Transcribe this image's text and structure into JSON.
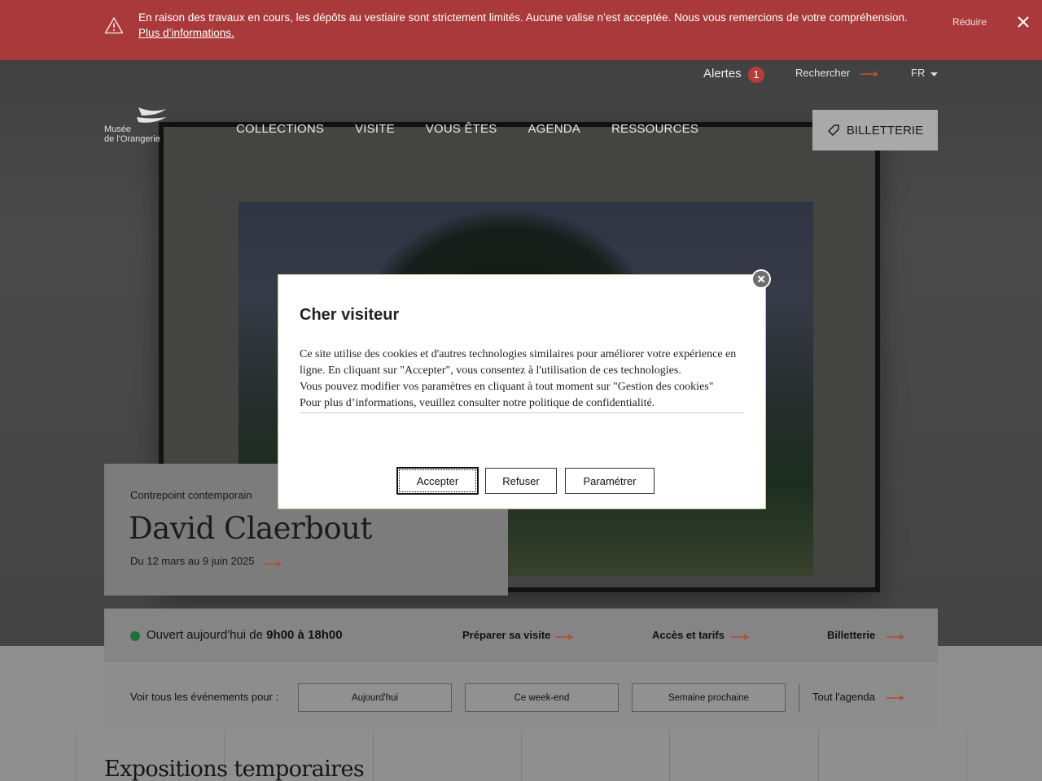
{
  "alert_banner": {
    "message": "En raison des travaux en cours, les dépôts au vestiaire sont strictement limités. Aucune valise n’est acceptée. Nous vous remercions de votre compréhension.",
    "link_label": "Plus d’informations.",
    "reduce_label": "Réduire"
  },
  "utility": {
    "alerts_label": "Alertes",
    "alerts_count": "1",
    "search_label": "Rechercher",
    "language": "FR"
  },
  "header": {
    "logo_line1": "Musée",
    "logo_line2": "de l'Orangerie",
    "nav": [
      "COLLECTIONS",
      "VISITE",
      "VOUS ÊTES",
      "AGENDA",
      "RESSOURCES"
    ],
    "ticket_label": "BILLETTERIE"
  },
  "exhibition": {
    "kicker": "Contrepoint contemporain",
    "title": "David Claerbout",
    "dates": "Du 12 mars au 9 juin 2025"
  },
  "info_bar": {
    "open_prefix": "Ouvert aujourd'hui de",
    "open_hours": "9h00 à 18h00",
    "links": [
      "Préparer sa visite",
      "Accès et tarifs",
      "Billetterie"
    ]
  },
  "events_bar": {
    "label": "Voir tous les événements pour :",
    "buttons": [
      "Aujourd'hui",
      "Ce week-end",
      "Semaine prochaine"
    ],
    "all_agenda": "Tout l'agenda"
  },
  "section": {
    "title": "Expositions temporaires"
  },
  "cookie_modal": {
    "title": "Cher visiteur",
    "text_line1": "Ce site utilise des cookies et d'autres technologies similaires pour améliorer votre expérience en ligne. En cliquant sur \"Accepter\", vous consentez à l'utilisation de ces technologies.",
    "text_line2": "Vous pouvez modifier vos paramètres en cliquant à tout moment sur \"Gestion des cookies\"",
    "text_line3": "Pour plus d’informations, veuillez consulter notre politique de confidentialité.",
    "accept_label": "Accepter",
    "refuse_label": "Refuser",
    "settings_label": "Paramétrer"
  },
  "colors": {
    "alert_red": "#a9393a",
    "accent_arrow": "#c0553a",
    "open_green": "#1d6e3a"
  }
}
